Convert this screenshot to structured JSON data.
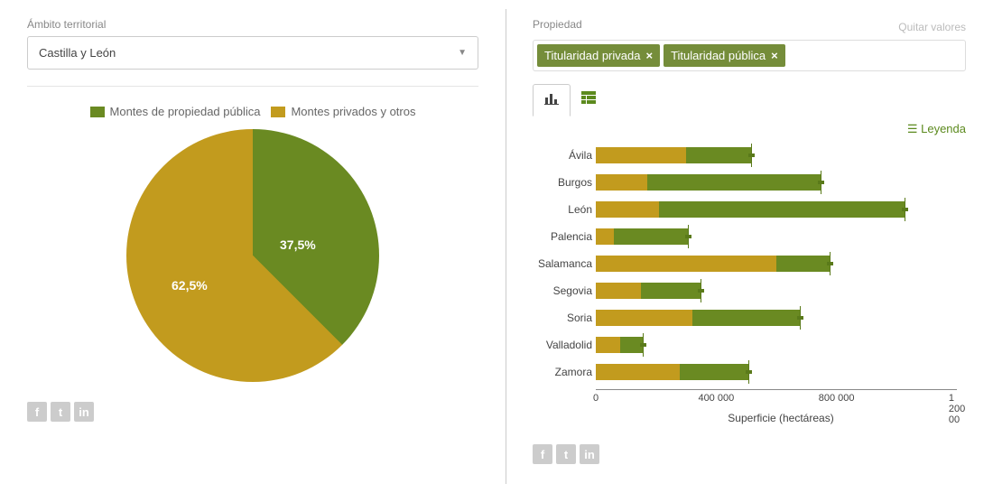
{
  "left": {
    "filter_label": "Ámbito territorial",
    "select_value": "Castilla y León",
    "legend": [
      {
        "label": "Montes de propiedad pública",
        "color": "#6a8a22"
      },
      {
        "label": "Montes privados y otros",
        "color": "#c29b1e"
      }
    ],
    "pie": {
      "public_pct_label": "37,5%",
      "private_pct_label": "62,5%"
    }
  },
  "right": {
    "filter_label": "Propiedad",
    "clear_label": "Quitar valores",
    "chips": [
      "Titularidad privada",
      "Titularidad pública"
    ],
    "legend_link": "Leyenda",
    "xlabel": "Superficie (hectáreas)",
    "xticks": [
      "0",
      "400 000",
      "800 000",
      "1 200 00"
    ]
  },
  "colors": {
    "public": "#6a8a22",
    "private": "#c29b1e"
  },
  "chart_data": [
    {
      "type": "pie",
      "title": "",
      "series": [
        {
          "name": "Montes de propiedad pública",
          "value": 37.5
        },
        {
          "name": "Montes privados y otros",
          "value": 62.5
        }
      ]
    },
    {
      "type": "bar",
      "orientation": "horizontal",
      "stacked": true,
      "xlabel": "Superficie (hectáreas)",
      "xlim": [
        0,
        1200000
      ],
      "xticks": [
        0,
        400000,
        800000,
        1200000
      ],
      "categories": [
        "Ávila",
        "Burgos",
        "León",
        "Palencia",
        "Salamanca",
        "Segovia",
        "Soria",
        "Valladolid",
        "Zamora"
      ],
      "series": [
        {
          "name": "Titularidad privada",
          "color": "#c29b1e",
          "values": [
            300000,
            170000,
            210000,
            60000,
            600000,
            150000,
            320000,
            80000,
            280000
          ]
        },
        {
          "name": "Titularidad pública",
          "color": "#6a8a22",
          "values": [
            220000,
            580000,
            820000,
            250000,
            180000,
            200000,
            360000,
            80000,
            230000
          ]
        }
      ],
      "totals": [
        520000,
        750000,
        1030000,
        310000,
        780000,
        350000,
        680000,
        160000,
        510000
      ]
    }
  ]
}
